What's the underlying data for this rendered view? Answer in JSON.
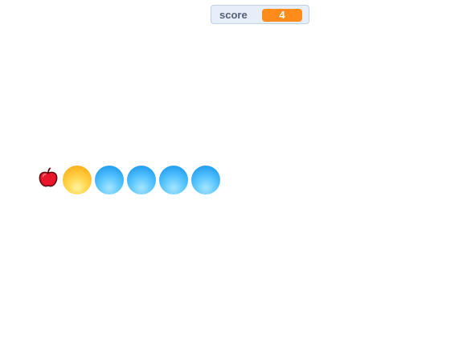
{
  "score": {
    "label": "score",
    "value": "4"
  },
  "apple": {
    "icon": "apple-icon",
    "color": "#e8152b"
  },
  "snake": {
    "head_color": "#ffc832",
    "body_color": "#2aa3f3",
    "segments": [
      {
        "kind": "head"
      },
      {
        "kind": "body"
      },
      {
        "kind": "body"
      },
      {
        "kind": "body"
      },
      {
        "kind": "body"
      }
    ]
  },
  "colors": {
    "monitor_bg": "#e6eef9",
    "monitor_border": "#c3d0e3",
    "value_bg": "#ff8c1a",
    "label_text": "#575e75"
  }
}
